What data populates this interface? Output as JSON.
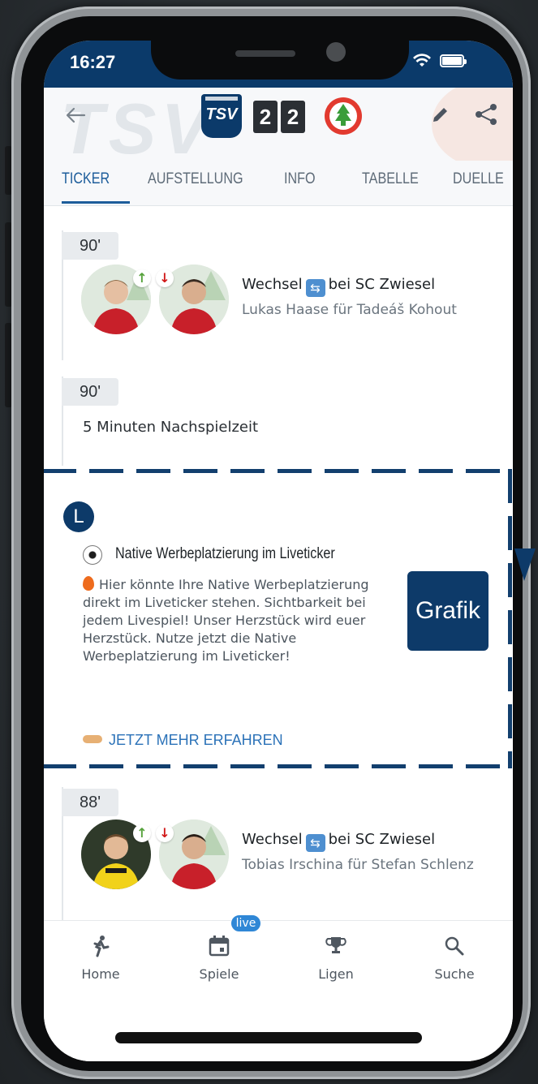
{
  "status_bar": {
    "time": "16:27"
  },
  "match": {
    "home_logo_text": "TSV",
    "home_score": "2",
    "away_score": "2",
    "header_watermark": "TSV"
  },
  "tabs": [
    {
      "label": "TICKER",
      "active": true
    },
    {
      "label": "AUFSTELLUNG",
      "active": false
    },
    {
      "label": "INFO",
      "active": false
    },
    {
      "label": "TABELLE",
      "active": false
    },
    {
      "label": "DUELLE",
      "active": false
    }
  ],
  "ticker": {
    "events": [
      {
        "minute": "90'",
        "type": "substitution",
        "title_prefix": "Wechsel",
        "title_suffix": "bei SC Zwiesel",
        "detail": "Lukas Haase für Tadeáš Kohout"
      },
      {
        "minute": "90'",
        "type": "text",
        "text": "5 Minuten Nachspielzeit"
      },
      {
        "minute": "88'",
        "type": "substitution",
        "title_prefix": "Wechsel",
        "title_suffix": "bei SC Zwiesel",
        "detail": "Tobias Irschina für Stefan Schlenz"
      }
    ]
  },
  "ad": {
    "marker": "L",
    "title": "Native Werbeplatzierung im Liveticker",
    "body": "Hier könnte Ihre Native Werbeplatzierung direkt im Liveticker stehen. Sichtbarkeit bei jedem Livespiel! Unser Herzstück wird euer Herzstück. Nutze jetzt die Native Werbeplatzierung im Liveticker!",
    "graphic_label": "Grafik",
    "cta": "JETZT MEHR ERFAHREN",
    "border_color": "#123f6e"
  },
  "bottom_nav": {
    "items": [
      {
        "label": "Home",
        "icon": "soccer-player-icon"
      },
      {
        "label": "Spiele",
        "icon": "calendar-icon"
      },
      {
        "label": "Ligen",
        "icon": "trophy-icon"
      },
      {
        "label": "Suche",
        "icon": "search-icon"
      }
    ],
    "live_badge": "live"
  },
  "colors": {
    "brand": "#0b3a6a",
    "accent": "#1d5d9b",
    "substitution_in": "#56a23c",
    "substitution_out": "#d11a1a"
  }
}
